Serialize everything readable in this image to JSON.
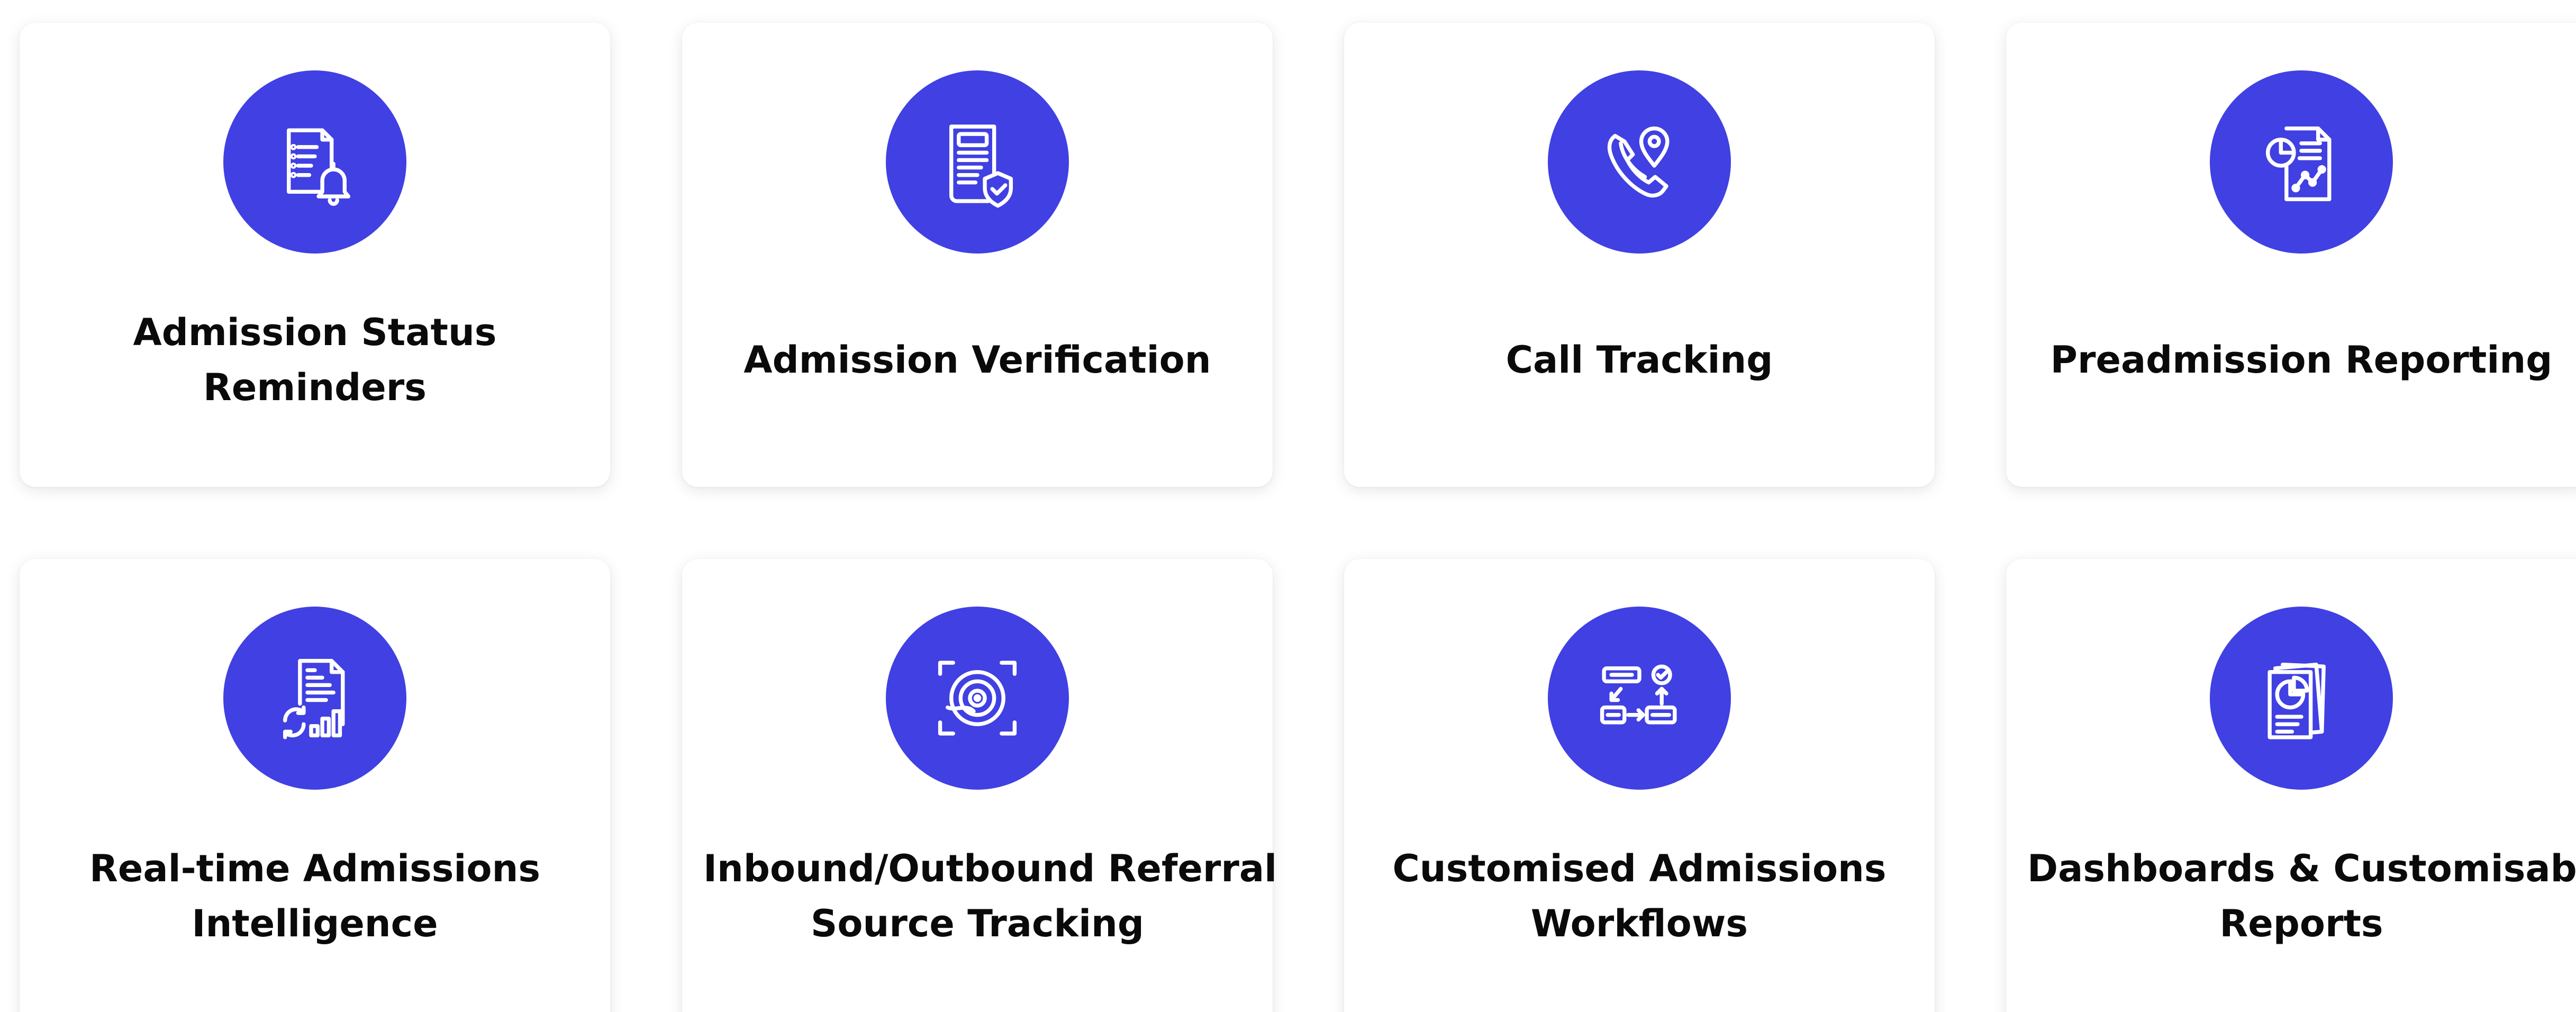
{
  "features": [
    {
      "title": "Admission Status Reminders",
      "title_lines": [
        "Admission Status",
        "Reminders"
      ],
      "icon": "document-bell-icon"
    },
    {
      "title": "Admission Verification",
      "title_lines": [
        "Admission Verification"
      ],
      "icon": "document-shield-check-icon"
    },
    {
      "title": "Call Tracking",
      "title_lines": [
        "Call Tracking"
      ],
      "icon": "phone-location-pin-icon"
    },
    {
      "title": "Preadmission Reporting",
      "title_lines": [
        "Preadmission Reporting"
      ],
      "icon": "report-pie-line-chart-icon"
    },
    {
      "title": "Real-time Admissions Intelligence",
      "title_lines": [
        "Real-time Admissions",
        "Intelligence"
      ],
      "icon": "document-refresh-bar-chart-icon"
    },
    {
      "title": "Inbound/Outbound Referral Source Tracking",
      "title_lines": [
        "Inbound/Outbound Referral",
        "Source Tracking"
      ],
      "icon": "target-scan-icon"
    },
    {
      "title": "Customised Admissions Workflows",
      "title_lines": [
        "Customised Admissions",
        "Workflows"
      ],
      "icon": "workflow-flowchart-icon"
    },
    {
      "title": "Dashboards & Customisable Reports",
      "title_lines": [
        "Dashboards & Customisable",
        "Reports"
      ],
      "icon": "report-stack-pie-chart-icon"
    }
  ],
  "colors": {
    "icon_background": "#4040e3",
    "icon_stroke": "#ffffff",
    "title_text": "#0a0a0a",
    "card_background": "#ffffff"
  }
}
